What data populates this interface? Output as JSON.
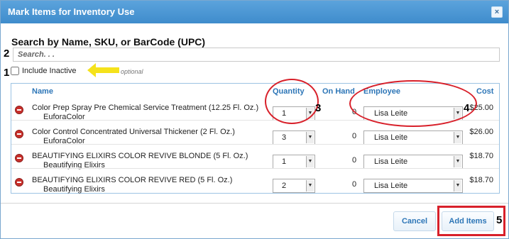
{
  "dialog": {
    "title": "Mark Items for Inventory Use",
    "close_glyph": "×"
  },
  "search": {
    "title": "Search by Name, SKU, or BarCode (UPC)",
    "placeholder": "Search. . ."
  },
  "include_inactive": {
    "label": "Include Inactive",
    "checked": false,
    "hint": "optional"
  },
  "annotations": [
    "1",
    "2",
    "3",
    "4",
    "5"
  ],
  "annotation_color": "#d8202a",
  "arrow_color": "#f5e21b",
  "table": {
    "columns": [
      "Name",
      "Quantity",
      "On Hand",
      "Employee",
      "Cost"
    ],
    "rows": [
      {
        "name": "Color Prep Spray Pre Chemical Service Treatment (12.25 Fl. Oz.)",
        "brand": "EuforaColor",
        "quantity": "1",
        "on_hand": "0",
        "employee": "Lisa Leite",
        "cost": "$25.00"
      },
      {
        "name": "Color Control Concentrated Universal Thickener (2 Fl. Oz.)",
        "brand": "EuforaColor",
        "quantity": "3",
        "on_hand": "0",
        "employee": "Lisa Leite",
        "cost": "$26.00"
      },
      {
        "name": "BEAUTIFYING ELIXIRS COLOR REVIVE BLONDE (5 Fl. Oz.)",
        "brand": "Beautifying Elixirs",
        "quantity": "1",
        "on_hand": "0",
        "employee": "Lisa Leite",
        "cost": "$18.70"
      },
      {
        "name": "BEAUTIFYING ELIXIRS COLOR REVIVE RED (5 Fl. Oz.)",
        "brand": "Beautifying Elixirs",
        "quantity": "2",
        "on_hand": "0",
        "employee": "Lisa Leite",
        "cost": "$18.70"
      }
    ]
  },
  "icons": {
    "remove": "remove-icon",
    "dropdown": "chevron-down-icon",
    "close": "close-icon"
  },
  "footer": {
    "cancel_label": "Cancel",
    "add_label": "Add Items"
  }
}
